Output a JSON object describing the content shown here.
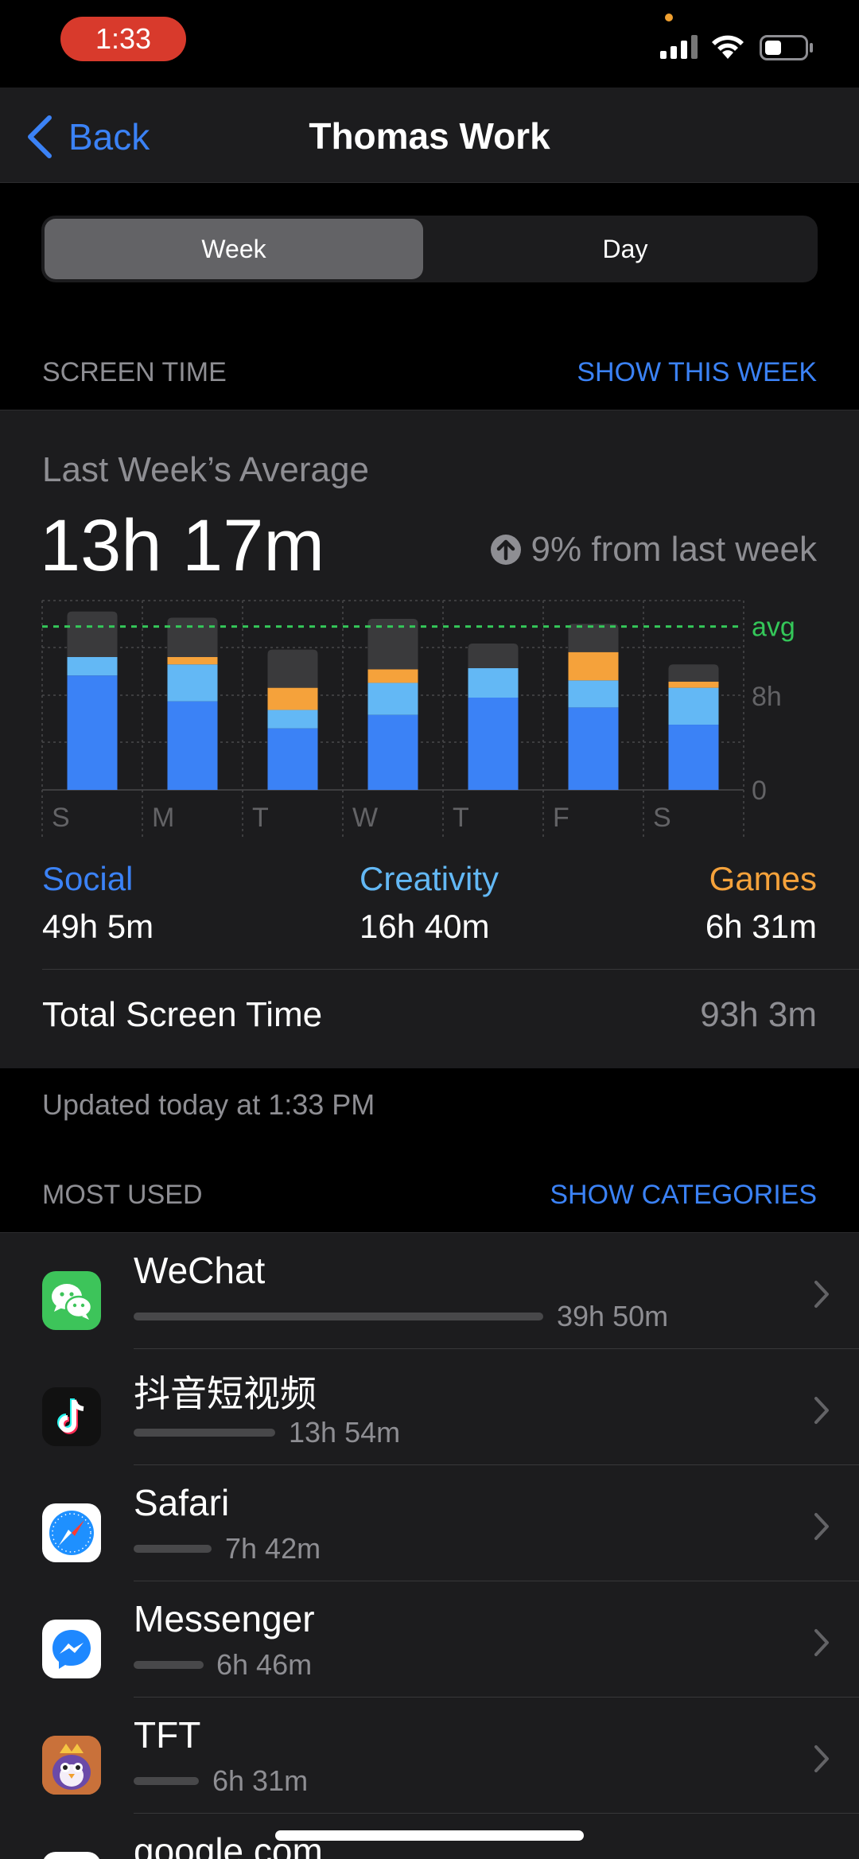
{
  "status_bar": {
    "time": "1:33"
  },
  "nav": {
    "back_label": "Back",
    "title": "Thomas Work"
  },
  "segmented": {
    "week": "Week",
    "day": "Day",
    "selected": "Week"
  },
  "screen_time": {
    "header": "SCREEN TIME",
    "action": "SHOW THIS WEEK",
    "avg_label": "Last Week’s Average",
    "avg_value": "13h 17m",
    "change": "9% from last week",
    "chart_labels": {
      "avg": "avg",
      "tick_high": "8h",
      "tick_zero": "0"
    },
    "categories": [
      {
        "name": "Social",
        "value": "49h 5m",
        "color": "#3b82f6"
      },
      {
        "name": "Creativity",
        "value": "16h 40m",
        "color": "#63b8f5"
      },
      {
        "name": "Games",
        "value": "6h 31m",
        "color": "#f5a23b"
      }
    ],
    "total_label": "Total Screen Time",
    "total_value": "93h 3m",
    "updated": "Updated today at 1:33 PM"
  },
  "chart_data": {
    "type": "bar",
    "stacked": true,
    "categories": [
      "S",
      "M",
      "T",
      "W",
      "T",
      "F",
      "S"
    ],
    "y_ticks": [
      "0",
      "8h"
    ],
    "ylim": [
      0,
      15
    ],
    "avg_line": 13.28,
    "series": [
      {
        "name": "Social",
        "color": "#3b82f6",
        "values": [
          9.3,
          7.2,
          5.0,
          6.1,
          7.5,
          6.7,
          5.3
        ]
      },
      {
        "name": "Creativity",
        "color": "#63b8f5",
        "values": [
          1.5,
          3.0,
          1.5,
          2.6,
          2.4,
          2.2,
          3.0
        ]
      },
      {
        "name": "Games",
        "color": "#f5a23b",
        "values": [
          0,
          0.6,
          1.8,
          1.1,
          0,
          2.3,
          0.5
        ]
      },
      {
        "name": "Other",
        "color": "#3a3a3c",
        "values": [
          3.7,
          3.2,
          3.1,
          4.1,
          2.0,
          2.3,
          1.4
        ]
      }
    ]
  },
  "most_used": {
    "header": "MOST USED",
    "action": "SHOW CATEGORIES",
    "apps": [
      {
        "name": "WeChat",
        "duration": "39h 50m",
        "icon": "wechat-icon",
        "share": 1.0
      },
      {
        "name": "抖音短视频",
        "duration": "13h 54m",
        "icon": "douyin-icon",
        "share": 0.35
      },
      {
        "name": "Safari",
        "duration": "7h 42m",
        "icon": "safari-icon",
        "share": 0.19
      },
      {
        "name": "Messenger",
        "duration": "6h 46m",
        "icon": "messenger-icon",
        "share": 0.17
      },
      {
        "name": "TFT",
        "duration": "6h 31m",
        "icon": "tft-icon",
        "share": 0.16
      },
      {
        "name": "google.com",
        "duration": "",
        "icon": "web-icon",
        "share": 0
      }
    ]
  }
}
